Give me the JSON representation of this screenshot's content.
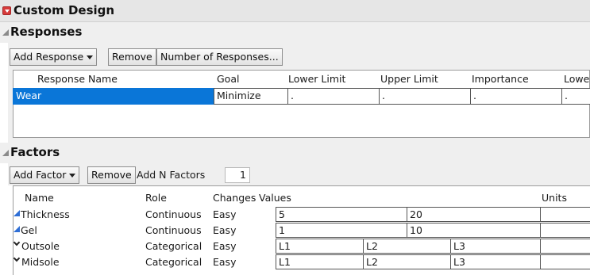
{
  "window": {
    "title": "Custom Design"
  },
  "responses": {
    "section_label": "Responses",
    "toolbar": {
      "add_response_label": "Add Response",
      "remove_label": "Remove",
      "number_of_responses_label": "Number of Responses..."
    },
    "columns": [
      "Response Name",
      "Goal",
      "Lower Limit",
      "Upper Limit",
      "Importance",
      "Lowe"
    ],
    "rows": [
      {
        "name": "Wear",
        "goal": "Minimize",
        "lower_limit": ".",
        "upper_limit": ".",
        "importance": ".",
        "lowe": "."
      }
    ]
  },
  "factors": {
    "section_label": "Factors",
    "toolbar": {
      "add_factor_label": "Add Factor",
      "remove_label": "Remove",
      "add_n_factors_label": "Add N Factors",
      "n_factors_value": "1"
    },
    "columns": [
      "Name",
      "Role",
      "Changes",
      "Values",
      "Units"
    ],
    "rows": [
      {
        "icon": "continuous-factor-icon",
        "name": "Thickness",
        "role": "Continuous",
        "changes": "Easy",
        "values": [
          "5",
          "20"
        ]
      },
      {
        "icon": "continuous-factor-icon",
        "name": "Gel",
        "role": "Continuous",
        "changes": "Easy",
        "values": [
          "1",
          "10"
        ]
      },
      {
        "icon": "categorical-factor-icon",
        "name": "Outsole",
        "role": "Categorical",
        "changes": "Easy",
        "values": [
          "L1",
          "L2",
          "L3"
        ]
      },
      {
        "icon": "categorical-factor-icon",
        "name": "Midsole",
        "role": "Categorical",
        "changes": "Easy",
        "values": [
          "L1",
          "L2",
          "L3"
        ]
      }
    ]
  },
  "colors": {
    "selection": "#0a76d8",
    "red_menu": "#d63a3a",
    "continuous_icon": "#2f6fd6",
    "panel_bg": "#efefef"
  }
}
